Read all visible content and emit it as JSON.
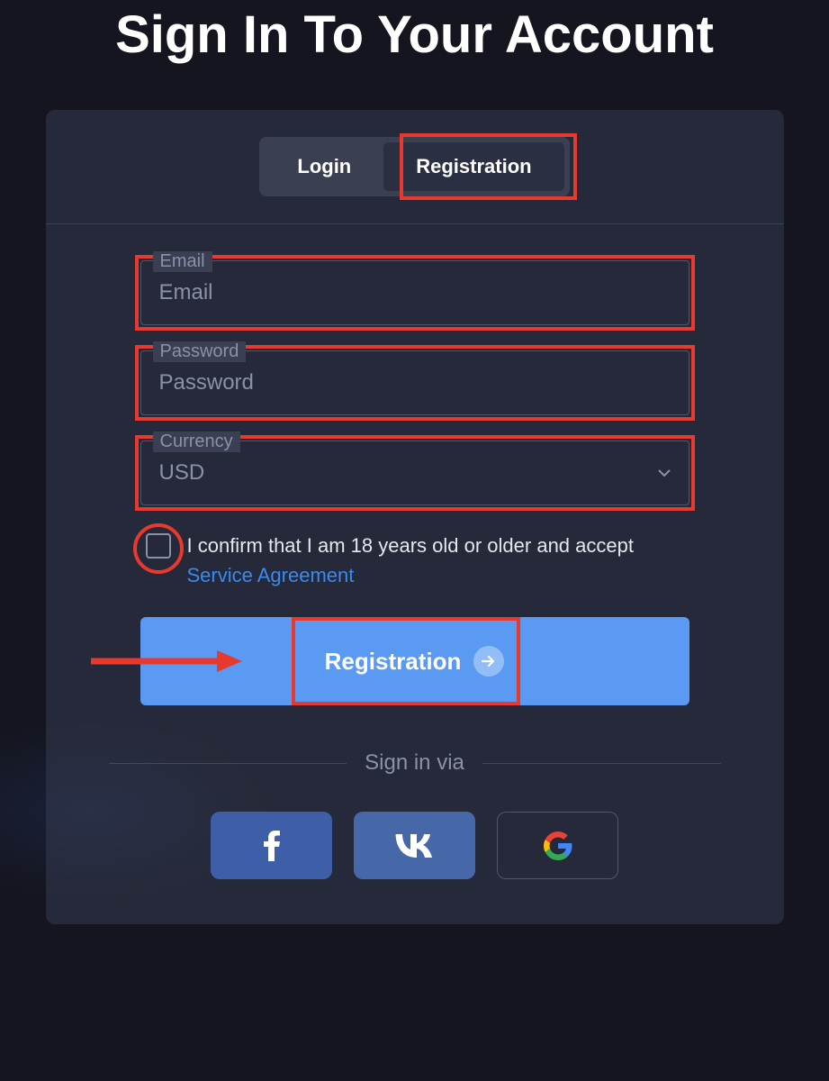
{
  "page_title": "Sign In To Your Account",
  "tabs": {
    "login_label": "Login",
    "registration_label": "Registration"
  },
  "fields": {
    "email": {
      "label": "Email",
      "placeholder": "Email"
    },
    "password": {
      "label": "Password",
      "placeholder": "Password"
    },
    "currency": {
      "label": "Currency",
      "value": "USD"
    }
  },
  "checkbox": {
    "text": "I confirm that I am 18 years old or older and accept ",
    "link_text": "Service Agreement"
  },
  "submit_label": "Registration",
  "divider_text": "Sign in via",
  "social": {
    "facebook": "facebook",
    "vk": "vk",
    "google": "google"
  }
}
